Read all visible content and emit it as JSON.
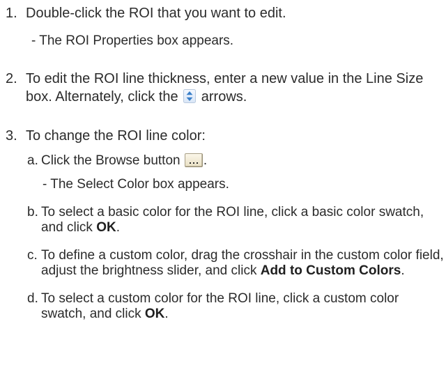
{
  "steps": [
    {
      "number": "1.",
      "text": "Double-click the ROI that you want to edit.",
      "note": "- The ROI Properties box appears."
    },
    {
      "number": "2.",
      "text_before_icon": "To edit the ROI line thickness, enter a new value in the Line Size box. Alternately, click the",
      "icon": "spin-arrows-icon",
      "text_after_icon": "arrows."
    },
    {
      "number": "3.",
      "text": "To change the ROI line color:",
      "substeps": [
        {
          "letter": "a.",
          "text_before_icon": "Click the Browse button",
          "icon": "browse-button-icon",
          "text_after_icon": ".",
          "note": "- The Select Color box appears."
        },
        {
          "letter": "b.",
          "text": "To select a basic color for the ROI line, click a basic color swatch, and click",
          "bold": "OK",
          "end": "."
        },
        {
          "letter": "c.",
          "text": "To define a custom color, drag the crosshair in the custom color field, adjust the brightness slider, and click",
          "bold": "Add to Custom Colors",
          "end": "."
        },
        {
          "letter": "d.",
          "text": "To select a custom color for the ROI line, click a custom color swatch, and click",
          "bold": "OK",
          "end": "."
        }
      ]
    }
  ]
}
